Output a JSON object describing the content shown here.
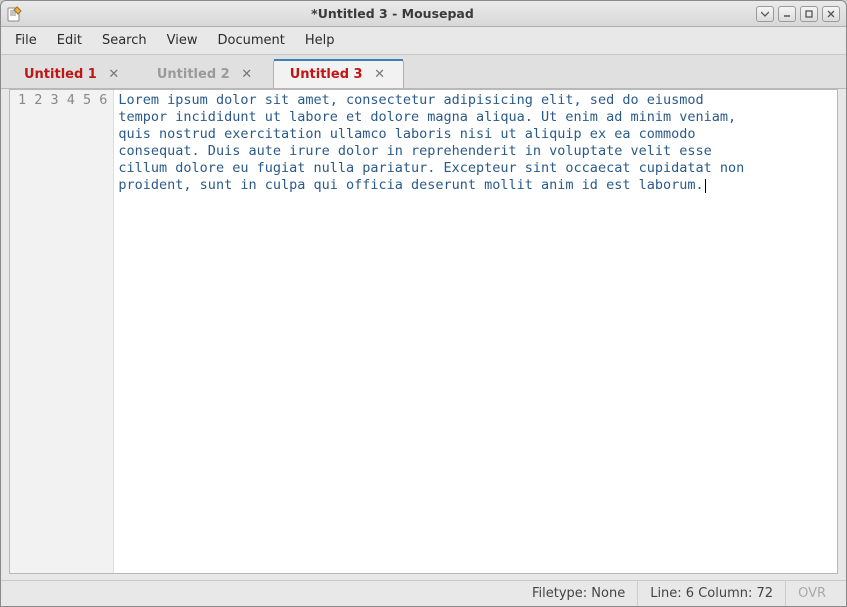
{
  "window": {
    "title": "*Untitled 3 - Mousepad"
  },
  "menubar": [
    "File",
    "Edit",
    "Search",
    "View",
    "Document",
    "Help"
  ],
  "tabs": [
    {
      "label": "Untitled 1",
      "modified": true,
      "active": false
    },
    {
      "label": "Untitled 2",
      "modified": false,
      "active": false
    },
    {
      "label": "Untitled 3",
      "modified": true,
      "active": true
    }
  ],
  "editor": {
    "lines": [
      "Lorem ipsum dolor sit amet, consectetur adipisicing elit, sed do eiusmod",
      "tempor incididunt ut labore et dolore magna aliqua. Ut enim ad minim veniam,",
      "quis nostrud exercitation ullamco laboris nisi ut aliquip ex ea commodo",
      "consequat. Duis aute irure dolor in reprehenderit in voluptate velit esse",
      "cillum dolore eu fugiat nulla pariatur. Excepteur sint occaecat cupidatat non",
      "proident, sunt in culpa qui officia deserunt mollit anim id est laborum."
    ]
  },
  "statusbar": {
    "filetype": "Filetype: None",
    "position": "Line: 6 Column: 72",
    "ovr": "OVR"
  }
}
